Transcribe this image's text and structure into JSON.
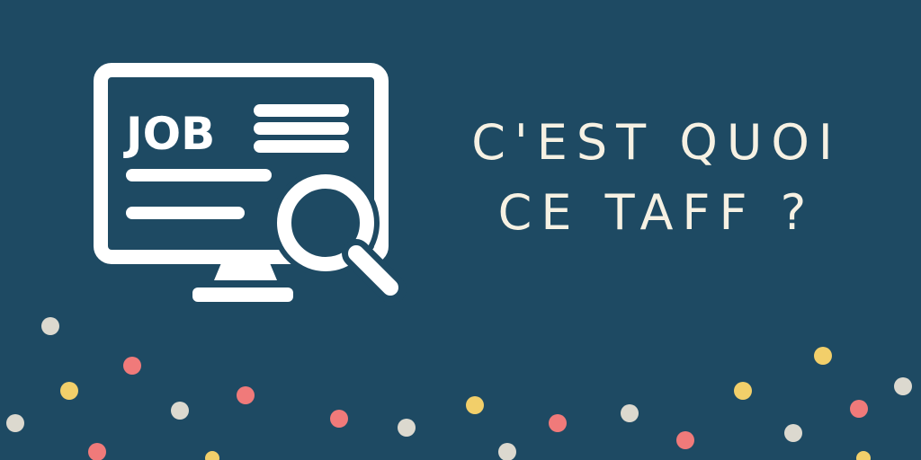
{
  "icon": {
    "name": "job-search-monitor-icon",
    "label": "JOB"
  },
  "headline": {
    "line1": "C'EST QUOI",
    "line2": "CE TAFF ?"
  },
  "colors": {
    "background": "#1e4a63",
    "foreground": "#ffffff",
    "text": "#f6f1e3",
    "dot_gray": "#dcd9cf",
    "dot_red": "#f07a7a",
    "dot_yellow": "#f2cf6a"
  }
}
